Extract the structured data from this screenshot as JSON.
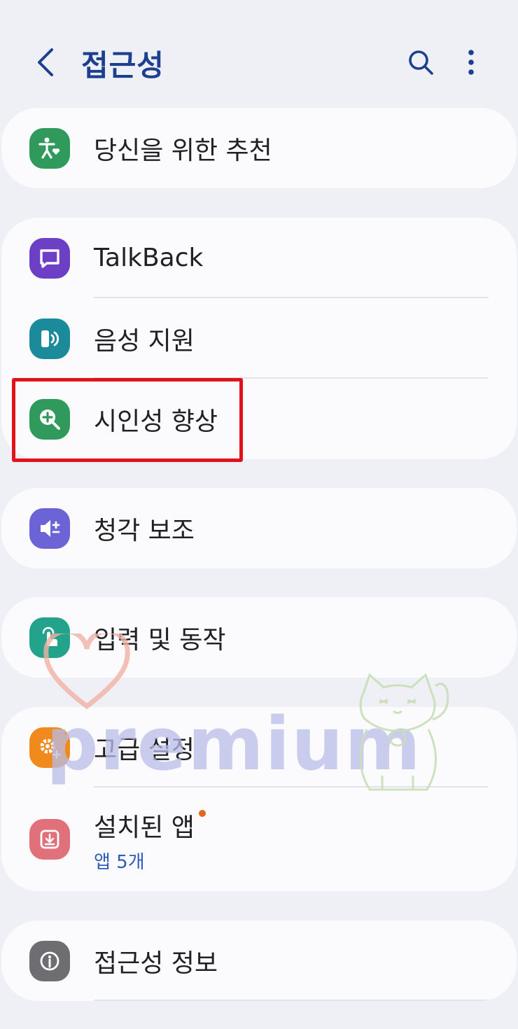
{
  "header": {
    "title": "접근성",
    "back_icon": "chevron-left-icon",
    "search_icon": "search-icon",
    "more_icon": "more-vertical-icon"
  },
  "groups": [
    {
      "items": [
        {
          "label": "당신을 위한 추천",
          "icon": "accessibility-heart-icon",
          "icon_color": "#2f9a5c"
        }
      ]
    },
    {
      "items": [
        {
          "label": "TalkBack",
          "icon": "talkback-icon",
          "icon_color": "#6d3fc4"
        },
        {
          "label": "음성 지원",
          "icon": "voice-assistant-icon",
          "icon_color": "#1b8a9a"
        },
        {
          "label": "시인성 향상",
          "icon": "zoom-in-icon",
          "icon_color": "#2f9a5c"
        }
      ]
    },
    {
      "items": [
        {
          "label": "청각 보조",
          "icon": "hearing-volume-icon",
          "icon_color": "#6b63d6"
        }
      ]
    },
    {
      "items": [
        {
          "label": "입력 및 동작",
          "icon": "touch-gesture-icon",
          "icon_color": "#23a28c"
        }
      ]
    },
    {
      "items": [
        {
          "label": "고급 설정",
          "icon": "gear-plus-icon",
          "icon_color": "#f08a1c"
        },
        {
          "label": "설치된 앱",
          "sub": "앱 5개",
          "icon": "download-app-icon",
          "icon_color": "#e0707a"
        }
      ]
    },
    {
      "items": [
        {
          "label": "접근성 정보",
          "icon": "info-icon",
          "icon_color": "#6d6d72"
        }
      ]
    }
  ],
  "watermark": {
    "text": "premium"
  }
}
